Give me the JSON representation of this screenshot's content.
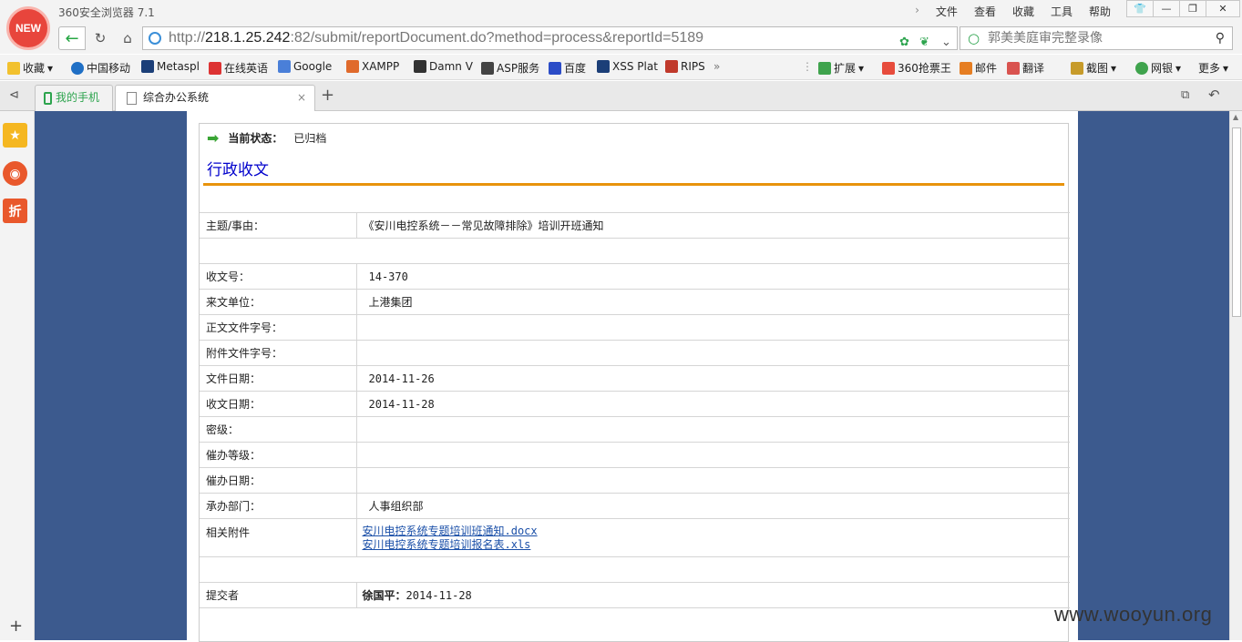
{
  "browser": {
    "logo_text": "NEW",
    "app_title": "360安全浏览器 7.1",
    "menus": [
      "文件",
      "查看",
      "收藏",
      "工具",
      "帮助"
    ],
    "url_host": "218.1.25.242",
    "url_rest": ":82/submit/reportDocument.do?method=process&reportId=5189",
    "url_scheme": "http://",
    "search_placeholder": "郭美美庭审完整录像",
    "bookmarks": [
      "收藏",
      "中国移动",
      "Metaspl",
      "在线英语",
      "Google",
      "XAMPP",
      "Damn V",
      "ASP服务",
      "百度",
      "XSS Plat",
      "RIPS"
    ],
    "tools": [
      "扩展",
      "360抢票王",
      "邮件",
      "翻译",
      "截图",
      "网银",
      "更多"
    ],
    "tabs": [
      "我的手机",
      "综合办公系统"
    ]
  },
  "doc": {
    "status_label": "当前状态：",
    "status_value": "已归档",
    "heading": "行政收文",
    "subject_label": "主题/事由：",
    "subject_value": "《安川电控系统－－常见故障排除》培训开班通知",
    "rows": [
      {
        "label": "收文号：",
        "value": "14-370"
      },
      {
        "label": "来文单位：",
        "value": "上港集团"
      },
      {
        "label": "正文文件字号：",
        "value": ""
      },
      {
        "label": "附件文件字号：",
        "value": ""
      },
      {
        "label": "文件日期：",
        "value": "2014-11-26"
      },
      {
        "label": "收文日期：",
        "value": "2014-11-28"
      },
      {
        "label": "密级：",
        "value": ""
      },
      {
        "label": "催办等级：",
        "value": ""
      },
      {
        "label": "催办日期：",
        "value": ""
      },
      {
        "label": "承办部门：",
        "value": "人事组织部"
      }
    ],
    "attach_label": "相关附件",
    "attachments": [
      "安川电控系统专题培训班通知.docx",
      "安川电控系统专题培训报名表.xls"
    ],
    "submitter_label": "提交者",
    "submitter_name": "徐国平：",
    "submitter_date": "2014-11-28"
  },
  "watermark": "www.wooyun.org"
}
